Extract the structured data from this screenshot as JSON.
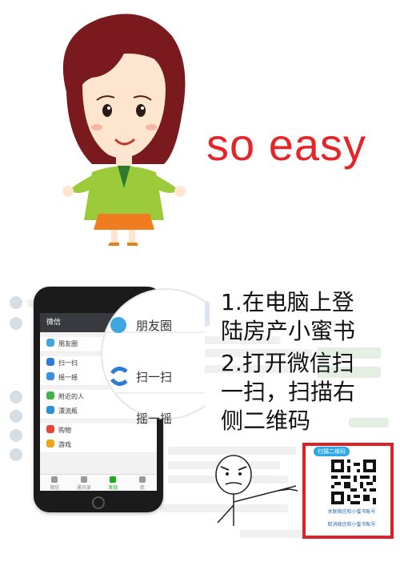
{
  "headline": {
    "text": "so easy"
  },
  "steps": {
    "step1_line1": "1.在电脑上登",
    "step1_line2": "陆房产小蜜书",
    "step2_line1": "2.打开微信扫",
    "step2_line2": "一扫，扫描右",
    "step2_line3": "侧二维码"
  },
  "phone": {
    "app_title": "微信",
    "menu": [
      {
        "label": "朋友圈",
        "icon_color": "#3fa7e0"
      },
      {
        "label": "扫一扫",
        "icon_color": "#2e7bd6"
      },
      {
        "label": "摇一摇",
        "icon_color": "#3a8fe0"
      },
      {
        "label": "附近的人",
        "icon_color": "#41b34a"
      },
      {
        "label": "漂流瓶",
        "icon_color": "#2b8fd8"
      },
      {
        "label": "购物",
        "icon_color": "#e8433a"
      },
      {
        "label": "游戏",
        "icon_color": "#f0a418"
      }
    ],
    "tabs": [
      {
        "label": "微信"
      },
      {
        "label": "通讯录"
      },
      {
        "label": "发现",
        "active": true
      },
      {
        "label": "我"
      }
    ]
  },
  "magnifier": {
    "item_top": "朋友圈",
    "item_mid": "扫一扫",
    "item_bottom": "摇一摇"
  },
  "qr": {
    "badge": "扫描二维码",
    "caption_1": "关联微信和小蜜书账号",
    "caption_2": "取消微信和小蜜书账号"
  },
  "colors": {
    "headline": "#e3262a",
    "qr_frame": "#d8232a",
    "wechat_green": "#1aad19"
  }
}
